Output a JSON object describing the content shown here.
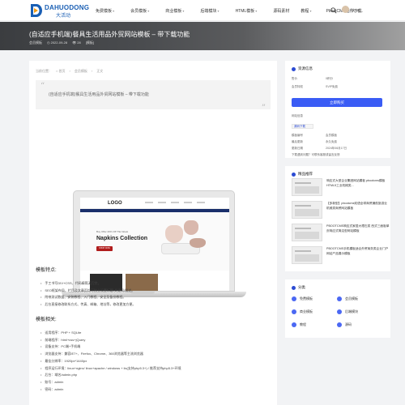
{
  "header": {
    "logo_text": "DAHUODONG",
    "logo_sub": "大活动",
    "nav": [
      {
        "label": "免费模板",
        "caret": true
      },
      {
        "label": "会员模板",
        "caret": true
      },
      {
        "label": "商业模板",
        "caret": true
      },
      {
        "label": "后端模块",
        "caret": true
      },
      {
        "label": "HTML模板",
        "caret": true
      },
      {
        "label": "源码素材",
        "caret": false
      },
      {
        "label": "教程",
        "caret": true
      },
      {
        "label": "PbootCMS插件下载",
        "caret": false
      }
    ],
    "username": "大河..."
  },
  "banner": {
    "title": "(自适应手机端)餐具生活用品外贸网站模板 – 带下载功能",
    "author": "会员模板",
    "date": "2022-09-28",
    "views": "28",
    "tag": "[模板]"
  },
  "breadcrumb": [
    "当前位置：",
    "首页",
    "会员模板",
    "正文"
  ],
  "quote": "(自适应手机端)餐具生活用品外贸网站模板 – 带下载功能",
  "preview": {
    "logo": "LOGO",
    "small": "Buy Offer 20% Off This Week",
    "headline": "Napkins Collection",
    "button": "SHOP NOW"
  },
  "features": {
    "title": "模板特点:",
    "items": [
      "手工书写DIV+CSS、代码精简无冗余。",
      "SEO框架布局，栏目及文章页均可独立设置标题/关键词/描述。",
      "附带测试数据、安装教程、入门教程、安全及备份教程。",
      "后台直接修改联系方式、传真、邮箱、地址等，修改更加方便。"
    ]
  },
  "params": {
    "title": "模板相关:",
    "items": [
      "适用程序：PHP + SQLite",
      "前端程序：html+css+jQuery",
      "设备支持：PC端+手机端",
      "浏览器支持：兼容IE7+、Firefox、Chrome、360浏览器等主流浏览器",
      "最佳分辨率：1920px*1440px",
      "程序运行环境：linux+nginx/ linux+apache / windows + iis(支持php5.3+) / 推荐支持php5.3+环境",
      "后台：域名/admin.php",
      "账号：admin",
      "密码：admin"
    ]
  },
  "sidebar": {
    "resource": {
      "title": "资源信息",
      "price_label": "售价",
      "price_value": "0积分",
      "member_label": "会员特权",
      "member_value": "SVIP免费",
      "button": "立即购买",
      "desc_label": "网站信息",
      "tag": "源码下载",
      "rows": [
        {
          "k": "模板编号",
          "v": "会员模板"
        },
        {
          "k": "最后更新",
          "v": "永久免费"
        },
        {
          "k": "更新日期",
          "v": "2024年06月17日"
        }
      ],
      "note": "下载遇到问题？可联系客服或留言反馈"
    },
    "recommend": {
      "title": "精品推荐",
      "items": [
        "响应式大型企业集团网站模板 pbootcms模板 HTML5工业机械类...",
        "【多新型】pbootcms双语全球商贸通航旅游业机械类商贸网站模板",
        "PBOOTCMS响应式家居大理石类 西式三面板单页响应式简洁型网站模板",
        "PBOOTCMS手机模板适合外贸商务类企业门户网站产品展示模板"
      ]
    },
    "tags": {
      "title": "分类",
      "items": [
        "免费模板",
        "会员模板",
        "商业模板",
        "后端模块",
        "教程",
        "源码"
      ]
    }
  },
  "colors": {
    "accent": "#3a5cf5",
    "brand": "#1a5fb4"
  }
}
